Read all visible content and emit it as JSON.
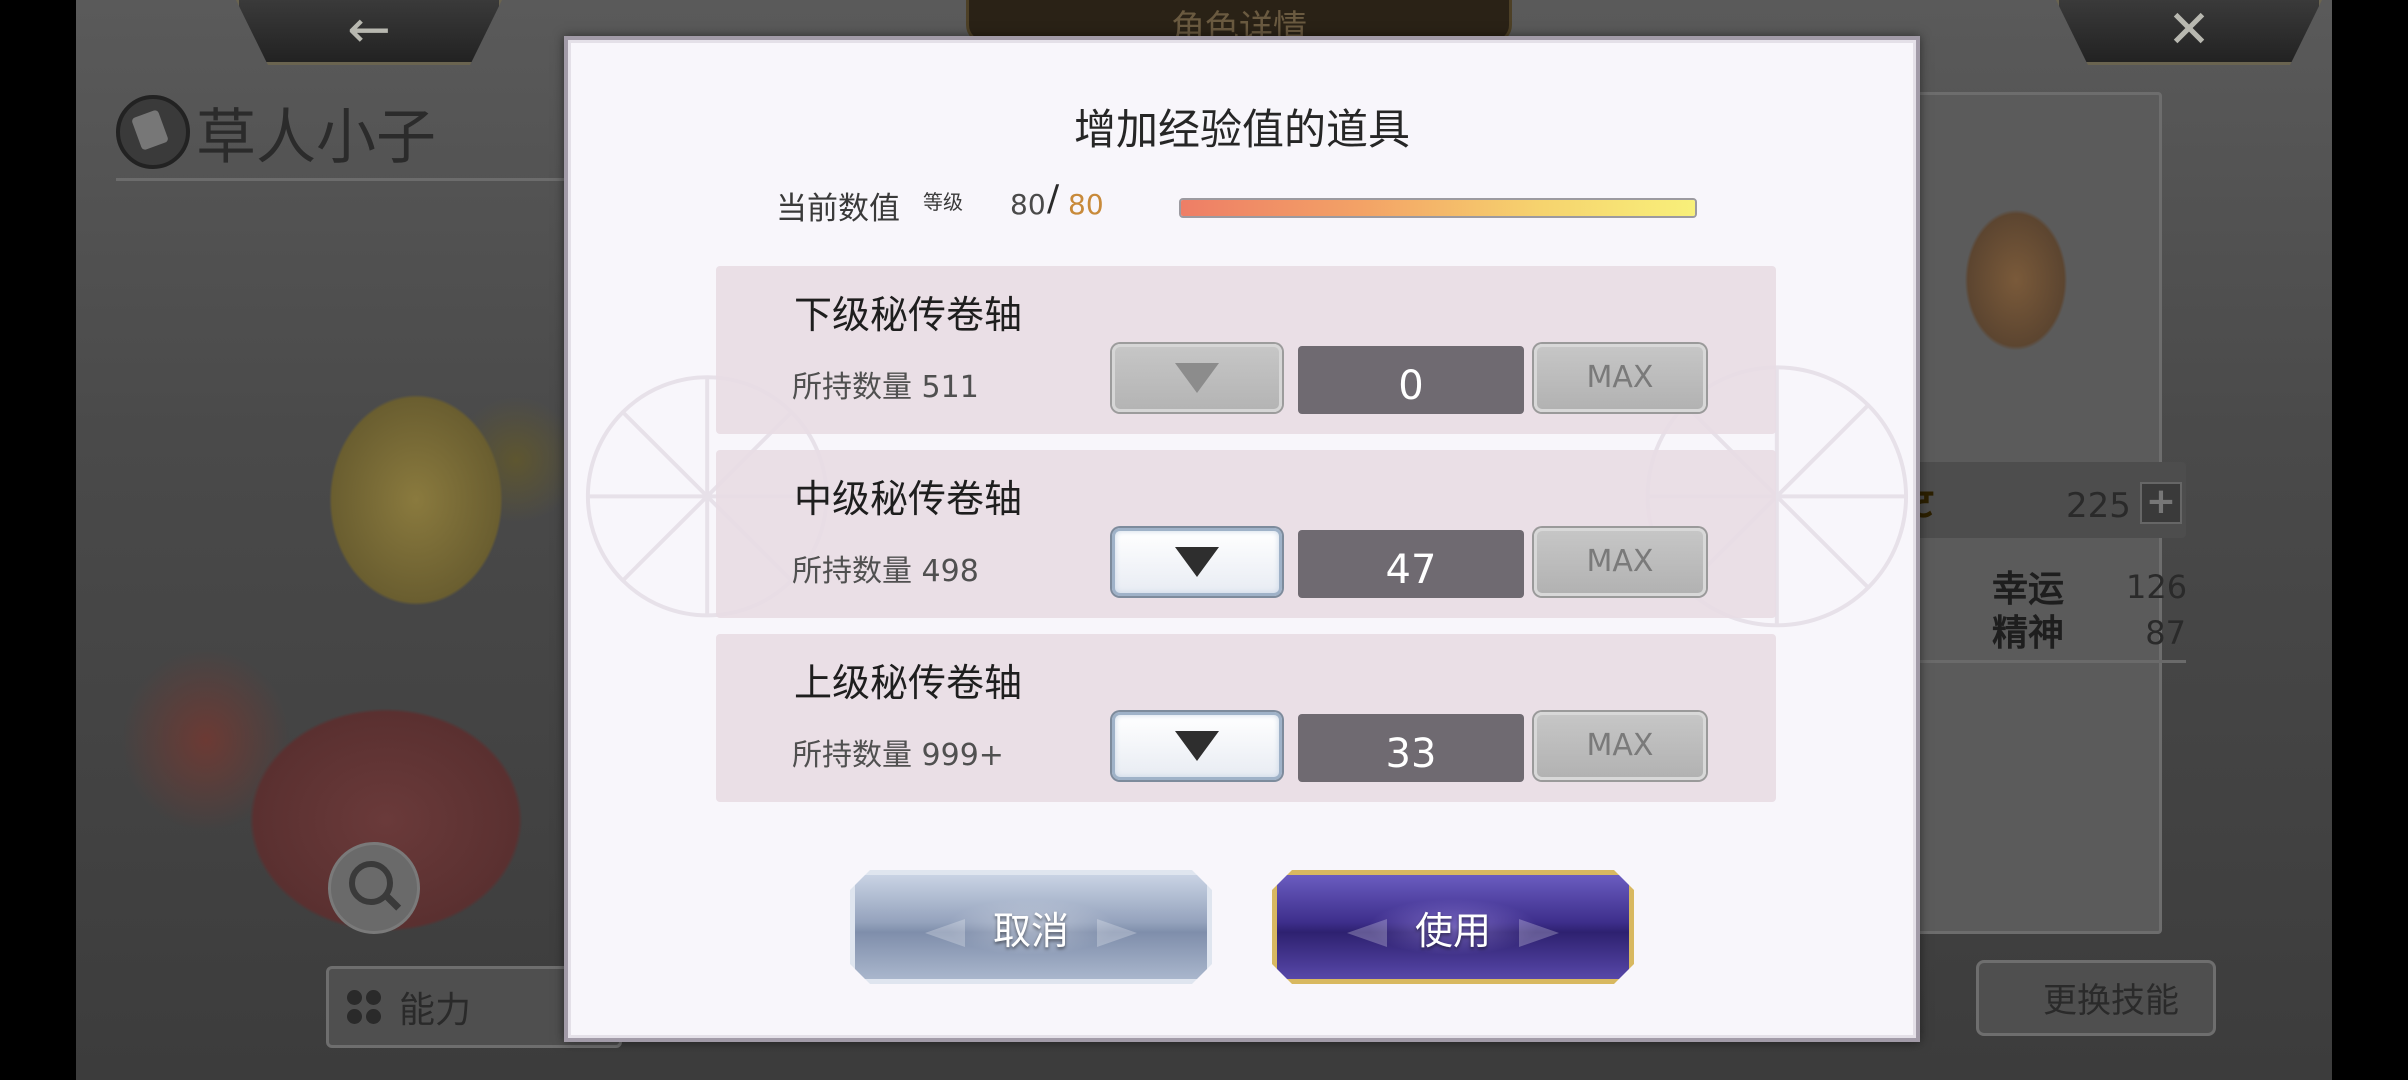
{
  "background": {
    "screen_title": "角色详情",
    "back_glyph": "←",
    "close_glyph": "✕",
    "character_name": "草人小子",
    "ability_button_label": "能力",
    "stat_points": "225",
    "stats": [
      {
        "label": "幸运",
        "value": "126"
      },
      {
        "label": "精神",
        "value": "87"
      }
    ],
    "change_skill_label": "更换技能"
  },
  "modal": {
    "title": "增加经验值的道具",
    "current_label": "当前数值",
    "level_tag": "等级",
    "level_current": "80",
    "level_slash": "/",
    "level_max": "80",
    "exp_progress": 1.0,
    "items": [
      {
        "name": "下级秘传卷轴",
        "owned_label": "所持数量 511",
        "quantity": "0",
        "decrease_enabled": false,
        "max_label": "MAX"
      },
      {
        "name": "中级秘传卷轴",
        "owned_label": "所持数量 498",
        "quantity": "47",
        "decrease_enabled": true,
        "max_label": "MAX"
      },
      {
        "name": "上级秘传卷轴",
        "owned_label": "所持数量 999+",
        "quantity": "33",
        "decrease_enabled": true,
        "max_label": "MAX"
      }
    ],
    "cancel_label": "取消",
    "use_label": "使用"
  },
  "colors": {
    "accent_gold": "#d8b860",
    "use_button": "#3e2f8c",
    "cancel_button": "#95a3bd",
    "level_max_color": "#c88a3a"
  },
  "icons": {
    "back": "back-arrow-icon",
    "close": "close-icon",
    "decrease": "triangle-down-icon",
    "magnify": "magnifier-icon",
    "ability": "grid-dots-icon",
    "plus": "plus-icon"
  }
}
